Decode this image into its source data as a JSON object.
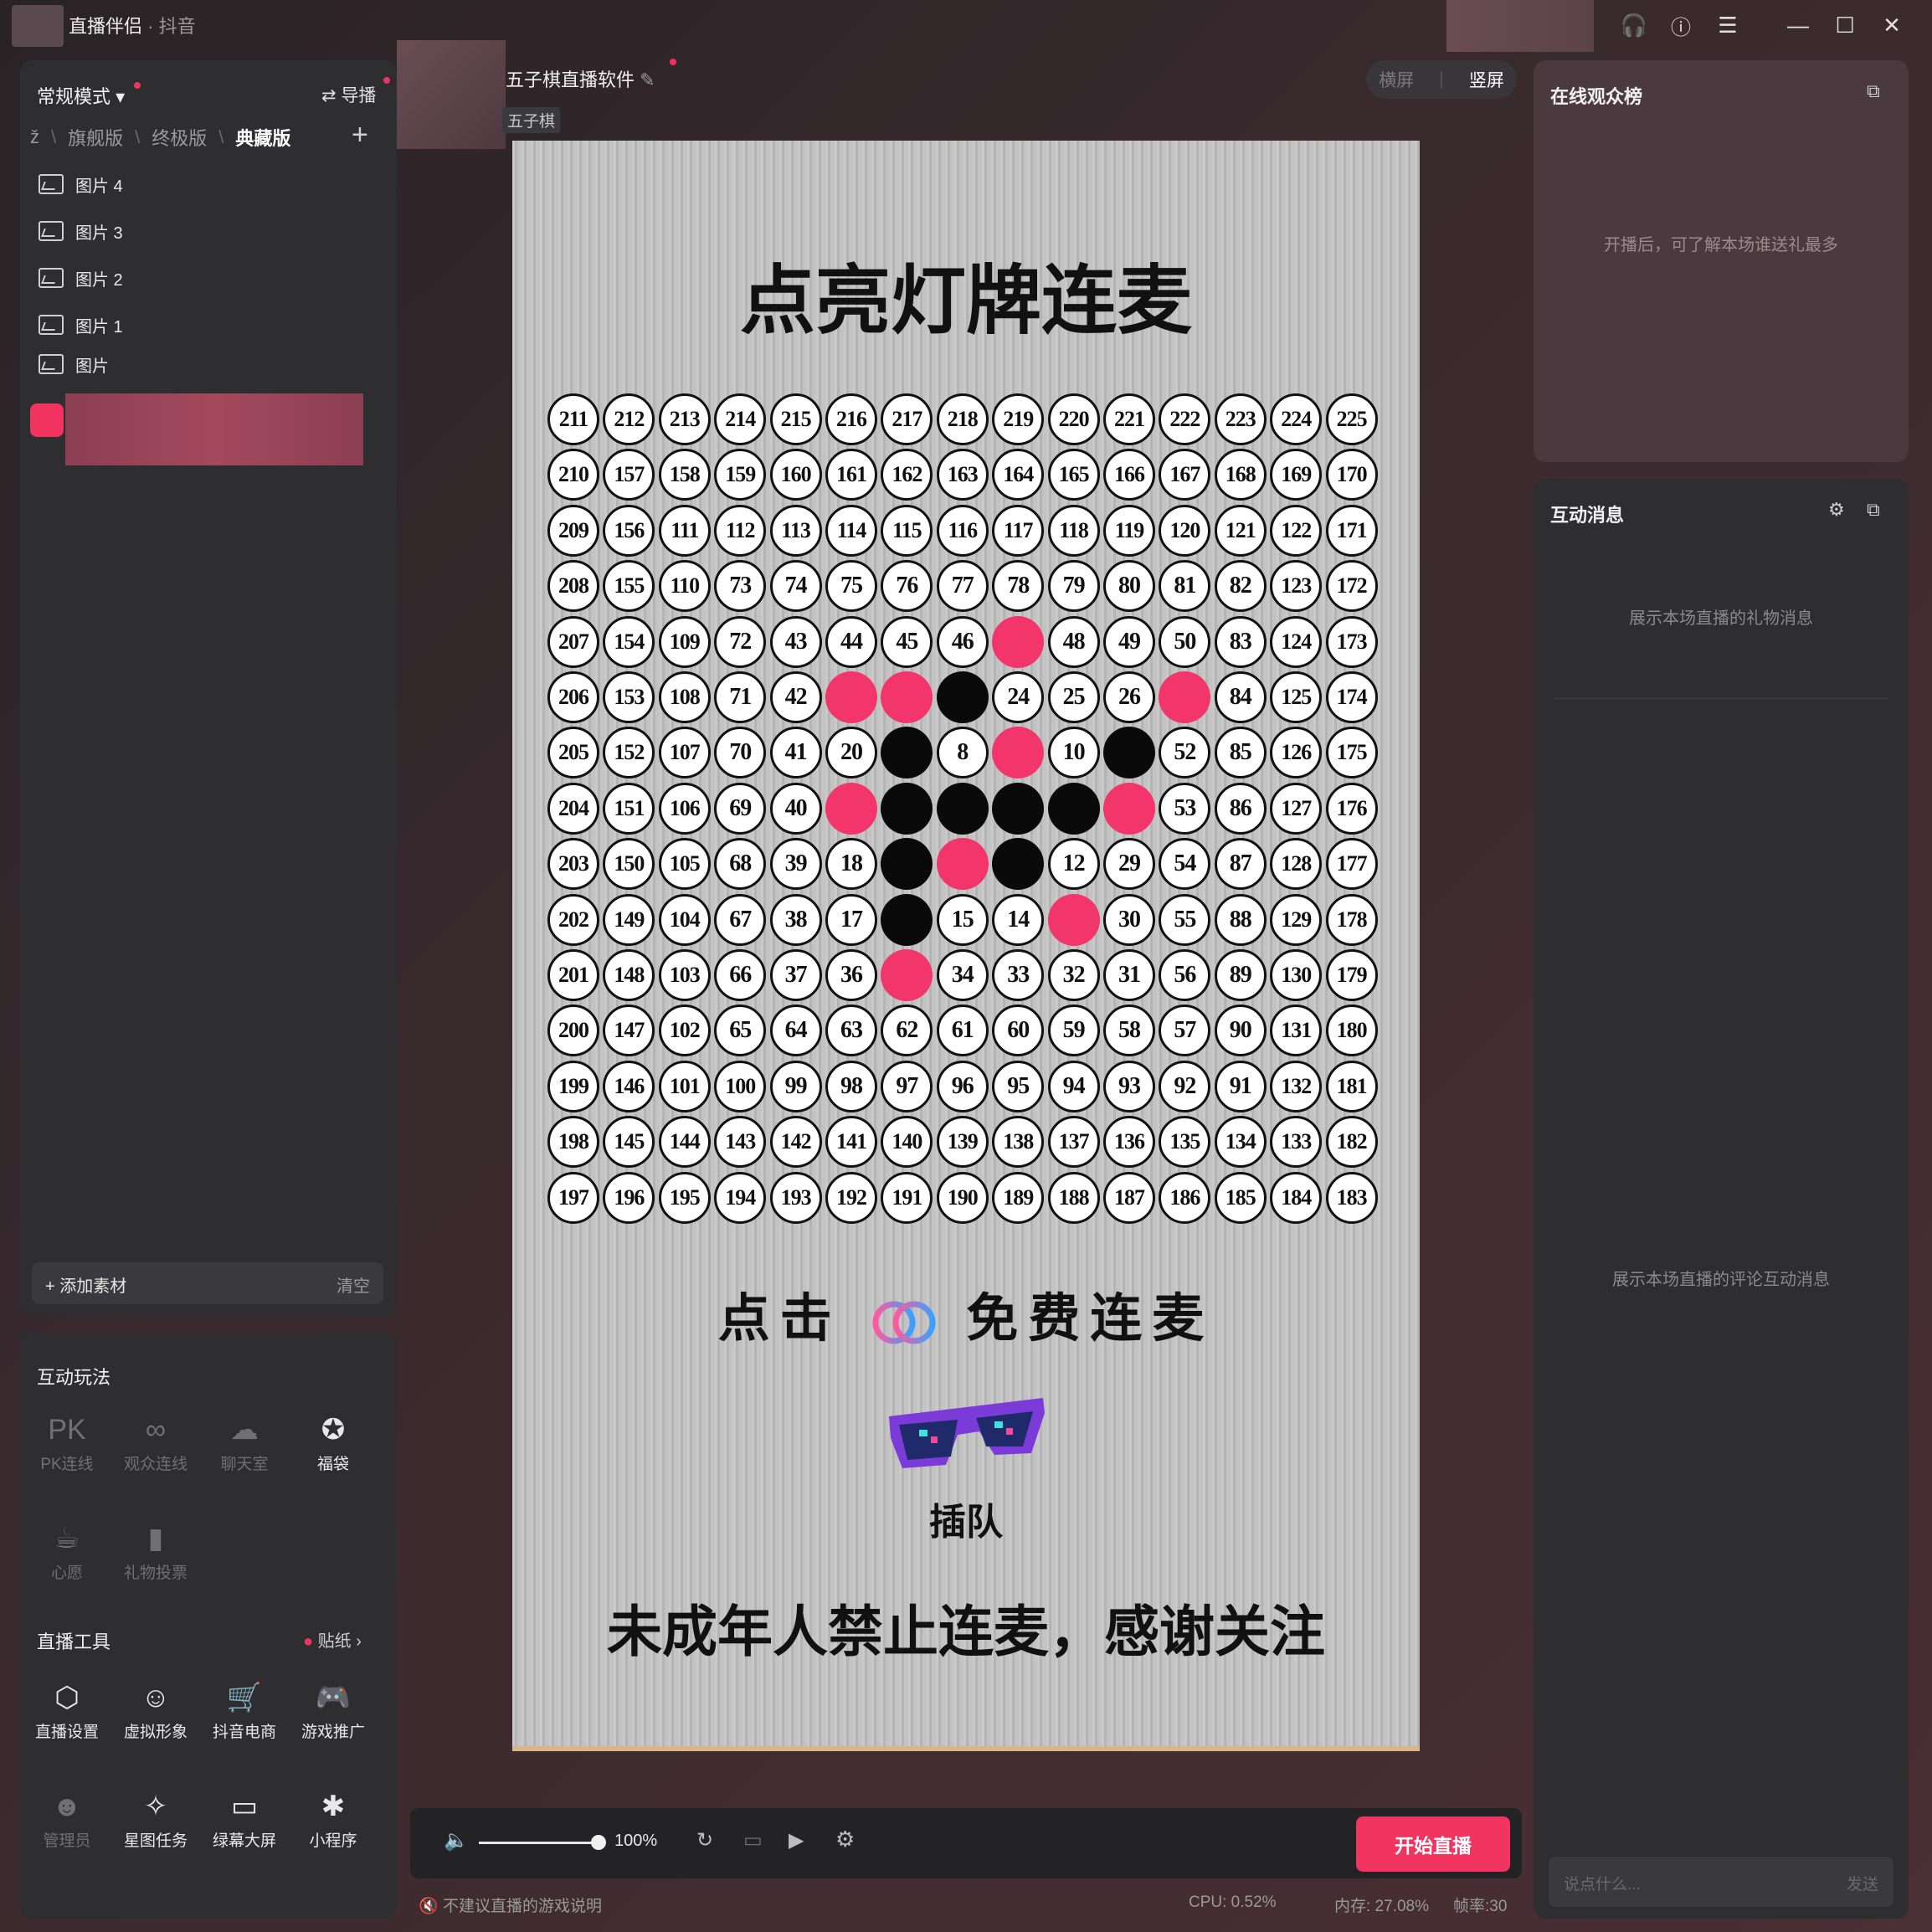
{
  "titlebar": {
    "app_name": "直播伴侣",
    "sub": "· 抖音"
  },
  "left": {
    "mode": "常规模式",
    "guide": "导播",
    "tabs": [
      "ž",
      "旗舰版",
      "终极版",
      "典藏版"
    ],
    "sources": [
      "图片 4",
      "图片 3",
      "图片 2",
      "图片 1",
      "图片"
    ],
    "add_material": "添加素材",
    "clear": "清空",
    "interactive_title": "互动玩法",
    "interactive": [
      {
        "label": "PK连线",
        "icon": "PK"
      },
      {
        "label": "观众连线",
        "icon": "∞"
      },
      {
        "label": "聊天室",
        "icon": "☁"
      },
      {
        "label": "福袋",
        "icon": "✪"
      },
      {
        "label": "心愿",
        "icon": "☕"
      },
      {
        "label": "礼物投票",
        "icon": "▮"
      }
    ],
    "tools_title": "直播工具",
    "sticker": "贴纸",
    "tools": [
      {
        "label": "直播设置",
        "icon": "⬡"
      },
      {
        "label": "虚拟形象",
        "icon": "☺"
      },
      {
        "label": "抖音电商",
        "icon": "🛒"
      },
      {
        "label": "游戏推广",
        "icon": "🎮"
      },
      {
        "label": "管理员",
        "icon": "☻"
      },
      {
        "label": "星图任务",
        "icon": "✧"
      },
      {
        "label": "绿幕大屏",
        "icon": "▭"
      },
      {
        "label": "小程序",
        "icon": "✱"
      }
    ]
  },
  "center": {
    "scene_title": "五子棋直播软件",
    "scene_tag": "五子棋",
    "orient_landscape": "横屏",
    "orient_portrait": "竖屏",
    "canvas_title": "点亮灯牌连麦",
    "click_text_a": "点击",
    "click_text_b": "免费连麦",
    "queue_label": "插队",
    "notice": "未成年人禁止连麦，感谢关注",
    "board": [
      [
        "211",
        "212",
        "213",
        "214",
        "215",
        "216",
        "217",
        "218",
        "219",
        "220",
        "221",
        "222",
        "223",
        "224",
        "225"
      ],
      [
        "210",
        "157",
        "158",
        "159",
        "160",
        "161",
        "162",
        "163",
        "164",
        "165",
        "166",
        "167",
        "168",
        "169",
        "170"
      ],
      [
        "209",
        "156",
        "111",
        "112",
        "113",
        "114",
        "115",
        "116",
        "117",
        "118",
        "119",
        "120",
        "121",
        "122",
        "171"
      ],
      [
        "208",
        "155",
        "110",
        "73",
        "74",
        "75",
        "76",
        "77",
        "78",
        "79",
        "80",
        "81",
        "82",
        "123",
        "172"
      ],
      [
        "207",
        "154",
        "109",
        "72",
        "43",
        "44",
        "45",
        "46",
        "P",
        "48",
        "49",
        "50",
        "83",
        "124",
        "173"
      ],
      [
        "206",
        "153",
        "108",
        "71",
        "42",
        "P",
        "P",
        "B",
        "24",
        "25",
        "26",
        "P",
        "84",
        "125",
        "174"
      ],
      [
        "205",
        "152",
        "107",
        "70",
        "41",
        "20",
        "B",
        "8",
        "P",
        "10",
        "B",
        "52",
        "85",
        "126",
        "175"
      ],
      [
        "204",
        "151",
        "106",
        "69",
        "40",
        "P",
        "B",
        "B",
        "B",
        "B",
        "P",
        "53",
        "86",
        "127",
        "176"
      ],
      [
        "203",
        "150",
        "105",
        "68",
        "39",
        "18",
        "B",
        "P",
        "B",
        "12",
        "29",
        "54",
        "87",
        "128",
        "177"
      ],
      [
        "202",
        "149",
        "104",
        "67",
        "38",
        "17",
        "B",
        "15",
        "14",
        "P",
        "30",
        "55",
        "88",
        "129",
        "178"
      ],
      [
        "201",
        "148",
        "103",
        "66",
        "37",
        "36",
        "P",
        "34",
        "33",
        "32",
        "31",
        "56",
        "89",
        "130",
        "179"
      ],
      [
        "200",
        "147",
        "102",
        "65",
        "64",
        "63",
        "62",
        "61",
        "60",
        "59",
        "58",
        "57",
        "90",
        "131",
        "180"
      ],
      [
        "199",
        "146",
        "101",
        "100",
        "99",
        "98",
        "97",
        "96",
        "95",
        "94",
        "93",
        "92",
        "91",
        "132",
        "181"
      ],
      [
        "198",
        "145",
        "144",
        "143",
        "142",
        "141",
        "140",
        "139",
        "138",
        "137",
        "136",
        "135",
        "134",
        "133",
        "182"
      ],
      [
        "197",
        "196",
        "195",
        "194",
        "193",
        "192",
        "191",
        "190",
        "189",
        "188",
        "187",
        "186",
        "185",
        "184",
        "183"
      ]
    ],
    "volume": "100%",
    "start_button": "开始直播",
    "status_left": "不建议直播的游戏说明",
    "cpu": "CPU: 0.52%",
    "mem": "内存: 27.08%",
    "fps": "帧率:30"
  },
  "right": {
    "audience_title": "在线观众榜",
    "audience_placeholder": "开播后，可了解本场谁送礼最多",
    "messages_title": "互动消息",
    "gift_placeholder": "展示本场直播的礼物消息",
    "comment_placeholder": "展示本场直播的评论互动消息",
    "input_placeholder": "说点什么...",
    "send": "发送"
  },
  "colors": {
    "accent": "#f0335f",
    "stone_black": "#0a0a0a",
    "stone_pink": "#f2356a"
  }
}
